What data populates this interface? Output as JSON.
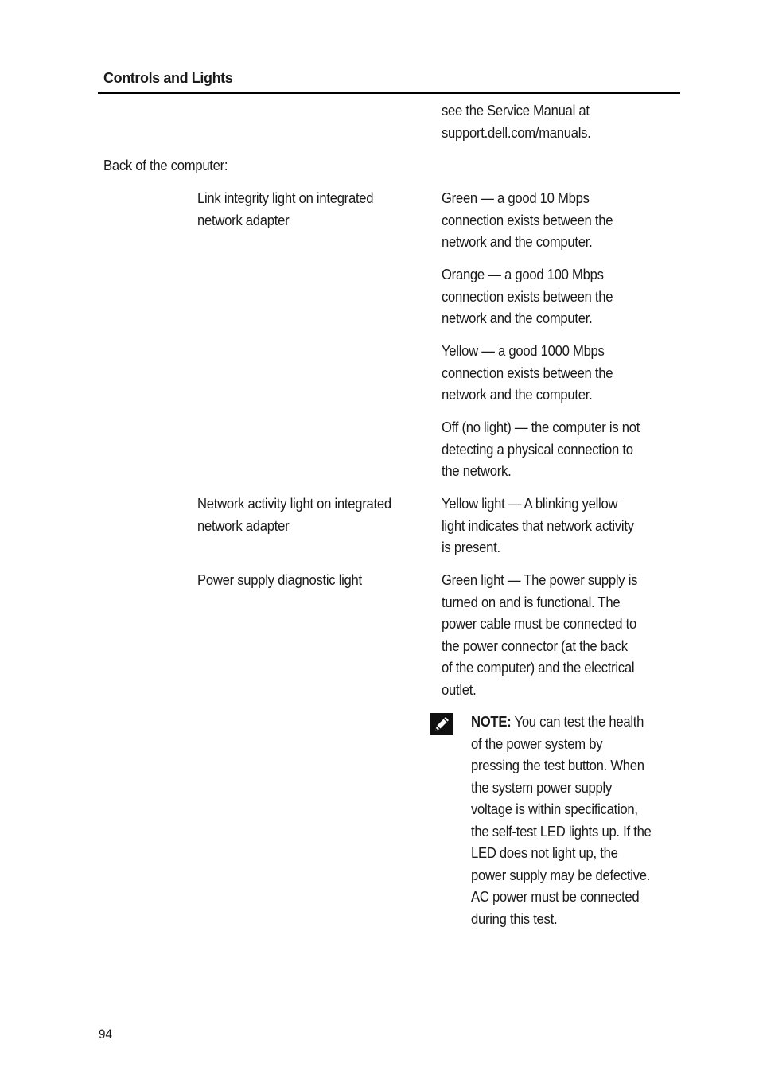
{
  "header": {
    "title": "Controls and Lights"
  },
  "continuation": "see the Service Manual at\nsupport.dell.com/manuals.",
  "section_label": "Back of the computer:",
  "rows": [
    {
      "label": "Link integrity light on integrated\nnetwork adapter",
      "descriptions": [
        "Green — a good 10 Mbps\nconnection exists between the\nnetwork and the computer.",
        "Orange — a good 100 Mbps\nconnection exists between the\nnetwork and the computer.",
        "Yellow — a good 1000 Mbps\nconnection exists between the\nnetwork and the computer.",
        "Off (no light) — the computer is not\ndetecting a physical connection to\nthe network."
      ]
    },
    {
      "label": "Network activity light on integrated\nnetwork adapter",
      "descriptions": [
        "Yellow light — A blinking yellow\nlight indicates that network activity\nis present."
      ]
    },
    {
      "label": "Power supply diagnostic light",
      "descriptions": [
        "Green light — The power supply is\nturned on and is functional. The\npower cable must be connected to\nthe power connector (at the back\nof the computer) and the electrical\noutlet."
      ]
    }
  ],
  "note": {
    "icon": "pencil-note-icon",
    "label": "NOTE:",
    "first_line_rest": " You can test the health",
    "text": "of the power system by\npressing the test button. When\nthe system power supply\nvoltage is within specification,\nthe self-test LED lights up. If the\nLED does not light up, the\npower supply may be defective.\nAC power must be connected\nduring this test."
  },
  "page_number": "94"
}
